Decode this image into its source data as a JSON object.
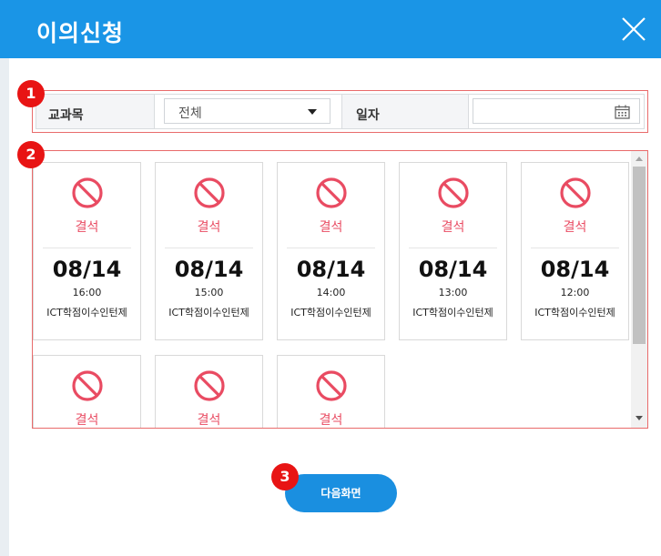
{
  "dialog": {
    "title": "이의신청"
  },
  "badges": [
    "1",
    "2",
    "3"
  ],
  "filter": {
    "course_label": "교과목",
    "course_value": "전체",
    "date_label": "일자",
    "date_value": ""
  },
  "cards": [
    {
      "status": "결석",
      "date": "08/14",
      "time": "16:00",
      "course": "ICT학점이수인턴제"
    },
    {
      "status": "결석",
      "date": "08/14",
      "time": "15:00",
      "course": "ICT학점이수인턴제"
    },
    {
      "status": "결석",
      "date": "08/14",
      "time": "14:00",
      "course": "ICT학점이수인턴제"
    },
    {
      "status": "결석",
      "date": "08/14",
      "time": "13:00",
      "course": "ICT학점이수인턴제"
    },
    {
      "status": "결석",
      "date": "08/14",
      "time": "12:00",
      "course": "ICT학점이수인턴제"
    },
    {
      "status": "결석"
    },
    {
      "status": "결석"
    },
    {
      "status": "결석"
    }
  ],
  "icons": {
    "close": "close-icon",
    "calendar": "calendar-icon",
    "status": "prohibited-icon"
  },
  "colors": {
    "header": "#1a95e6",
    "badge": "#e81414",
    "absent": "#e94b62",
    "button": "#1a8fe0",
    "highlight_border": "#e96b6b"
  },
  "actions": {
    "next_label": "다음화면"
  }
}
